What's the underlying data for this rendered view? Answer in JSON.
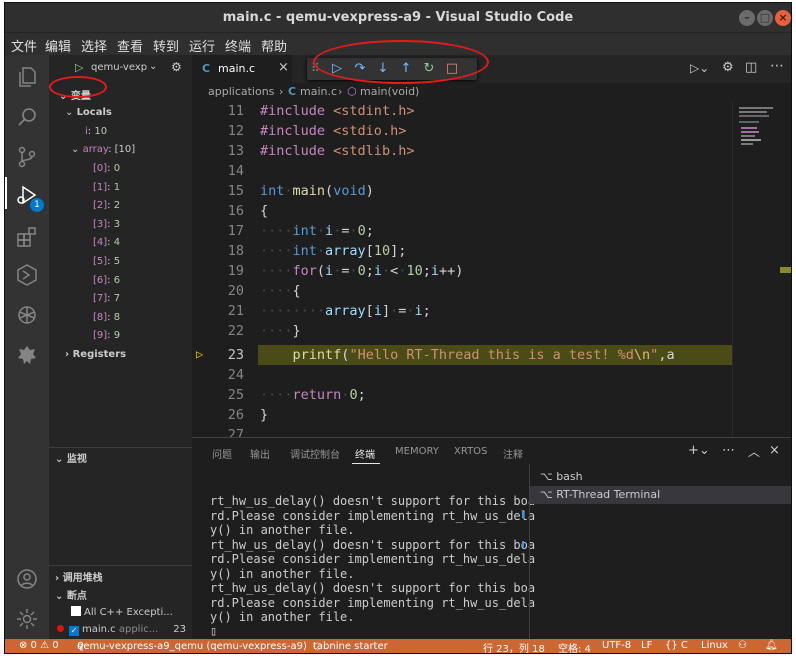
{
  "window": {
    "title": "main.c - qemu-vexpress-a9 - Visual Studio Code"
  },
  "menu": [
    "文件",
    "编辑",
    "选择",
    "查看",
    "转到",
    "运行",
    "终端",
    "帮助"
  ],
  "debug_config": {
    "name": "qemu-vexp"
  },
  "sidebar": {
    "variables_header": "变量",
    "locals_label": "Locals",
    "local_i": {
      "name": "i",
      "value": "10"
    },
    "array": {
      "name": "array",
      "value": "[10]"
    },
    "array_items": [
      {
        "idx": "[0]",
        "val": "0"
      },
      {
        "idx": "[1]",
        "val": "1"
      },
      {
        "idx": "[2]",
        "val": "2"
      },
      {
        "idx": "[3]",
        "val": "3"
      },
      {
        "idx": "[4]",
        "val": "4"
      },
      {
        "idx": "[5]",
        "val": "5"
      },
      {
        "idx": "[6]",
        "val": "6"
      },
      {
        "idx": "[7]",
        "val": "7"
      },
      {
        "idx": "[8]",
        "val": "8"
      },
      {
        "idx": "[9]",
        "val": "9"
      }
    ],
    "registers_label": "Registers",
    "watch_header": "监视",
    "callstack_header": "调用堆栈",
    "breakpoints_header": "断点",
    "bp_all_cpp": "All C++ Excepti...",
    "bp_main": "main.c",
    "bp_main_path": "applic...",
    "bp_main_line": "23"
  },
  "activity_badge": "1",
  "tab": {
    "label": "main.c"
  },
  "breadcrumb": {
    "folder": "applications",
    "file": "main.c",
    "symbol": "main(void)"
  },
  "editor": {
    "line_numbers": [
      "11",
      "12",
      "13",
      "14",
      "15",
      "16",
      "17",
      "18",
      "19",
      "20",
      "21",
      "22",
      "23",
      "24",
      "25",
      "26",
      "27"
    ],
    "current_line": "23"
  },
  "panel": {
    "tabs": [
      "问题",
      "输出",
      "调试控制台",
      "终端",
      "MEMORY",
      "XRTOS",
      "注释"
    ],
    "active_tab": "终端",
    "terminal_lines": [
      "rt_hw_us_delay() doesn't support for this boa",
      "rd.Please consider implementing rt_hw_us_dela",
      "y() in another file.",
      "rt_hw_us_delay() doesn't support for this boa",
      "rd.Please consider implementing rt_hw_us_dela",
      "y() in another file.",
      "rt_hw_us_delay() doesn't support for this boa",
      "rd.Please consider implementing rt_hw_us_dela",
      "y() in another file."
    ],
    "terminals": [
      "bash",
      "RT-Thread Terminal"
    ]
  },
  "status": {
    "problems": "⊗ 0 ⚠ 0",
    "debug": "qemu-vexpress-a9_qemu (qemu-vexpress-a9)",
    "tabnine": "tabnine starter",
    "position": "行 23，列 18",
    "spaces": "空格: 4",
    "encoding": "UTF-8",
    "eol": "LF",
    "lang_mode": "{} C",
    "os": "Linux"
  },
  "colors": {
    "status_bar": "#cc6633",
    "annotation": "#e21b1b",
    "debug_icons": "#75beff"
  }
}
